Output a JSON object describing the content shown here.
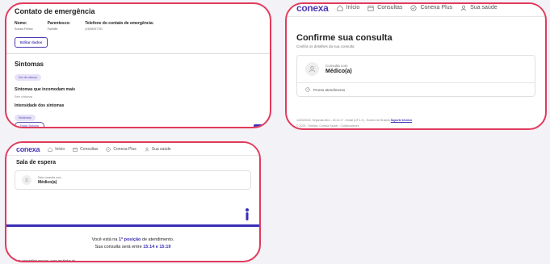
{
  "emergency_contact": {
    "title": "Contato de emergência",
    "fields": [
      {
        "label": "Nome:",
        "value": "Sonaia Freitos"
      },
      {
        "label": "Parentesco:",
        "value": "Pai/Mãe"
      },
      {
        "label": "Telefone do contato de emergência:",
        "value": "(19)98207751"
      }
    ],
    "edit_button": "Editar dados"
  },
  "symptoms": {
    "title": "Sintomas",
    "chip": "Dor de cabeça",
    "bothering_label": "Sintomas que incomodam mais",
    "bothering_value": "Sem sintomas",
    "intensity_label": "Intensidade dos sintomas",
    "intensity_value": "Moderado",
    "bottom_button": "Editar Sintoma"
  },
  "confirm": {
    "brand": "conexa",
    "nav": [
      "Início",
      "Consultas",
      "Conexa Plus",
      "Sua saúde"
    ],
    "title": "Confirme sua consulta",
    "subtitle": "Confira os detalhes da sua consulta",
    "consult_label": "Consulta com",
    "doctor": "Médico(a)",
    "status": "Pronto atendimento",
    "footer_line1": "14/03/2023, Segunda-feira - 15:12:17 - Brasil (UTC-3) - Horário de Brasília",
    "support_link": "Suporte técnico",
    "footer_line2": "© 2023 - Direitos: Conexa Saúde - Colaboradores"
  },
  "waiting": {
    "brand": "conexa",
    "nav": [
      "Início",
      "Consultas",
      "Conexa Plus",
      "Sua saúde"
    ],
    "title": "Sala de espera",
    "consult_label": "Sala consulta com",
    "doctor": "Médico(a)",
    "position_pre": "Você está na ",
    "position_value": "1ª posição",
    "position_post": " de atendimento.",
    "time_pre": "Sua consulta será entre ",
    "time_value": "15:14 e 15:19",
    "note": "ode compartilhar arquivos, como resultados de"
  },
  "colors": {
    "frame": "#e23a5b",
    "accent": "#3b2db5",
    "background": "#f3f2f7"
  }
}
